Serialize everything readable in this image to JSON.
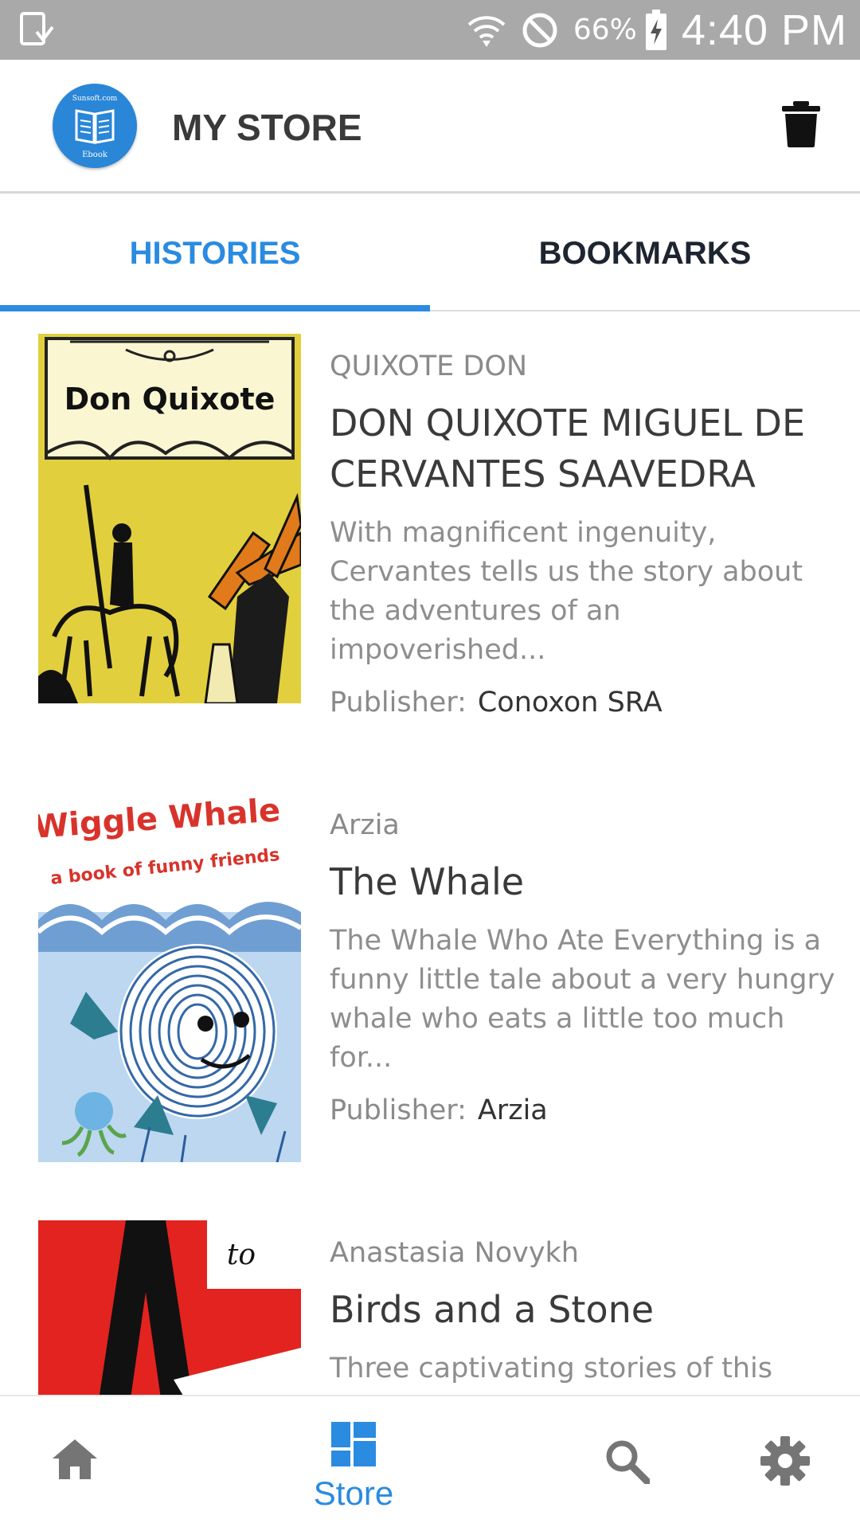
{
  "status_bar": {
    "battery_percent": "66%",
    "time": "4:40 PM",
    "icons": [
      "download-notification-icon",
      "wifi-icon",
      "do-not-disturb-icon",
      "battery-charging-icon"
    ]
  },
  "app_bar": {
    "title": "MY STORE",
    "logo_top_text": "Sunsoft.com",
    "logo_bottom_text": "Ebook",
    "action_icon": "trash-icon"
  },
  "tabs": [
    {
      "label": "HISTORIES",
      "selected": true
    },
    {
      "label": "BOOKMARKS",
      "selected": false
    }
  ],
  "books": [
    {
      "author": "QUIXOTE DON",
      "title": "DON QUIXOTE MIGUEL DE CERVANTES SAAVEDRA",
      "description": "With magnificent ingenuity, Cervantes tells us the story about the adventures of an impoverished...",
      "publisher_label": "Publisher:",
      "publisher": "Conoxon SRA",
      "cover_text": "Don Quixote"
    },
    {
      "author": "Arzia",
      "title": "The Whale",
      "description": "The Whale Who Ate Everything is a funny little tale about a very hungry whale who eats a little too much for...",
      "publisher_label": "Publisher:",
      "publisher": "Arzia",
      "cover_text": "Wiggle Whale",
      "cover_subtext": "a book of funny friends"
    },
    {
      "author": "Anastasia Novykh",
      "title": "Birds and a Stone",
      "description": "Three captivating stories of this book:",
      "cover_text": "to"
    }
  ],
  "bottom_nav": {
    "items": [
      {
        "icon": "home-icon",
        "label": ""
      },
      {
        "icon": "store-icon",
        "label": "Store",
        "selected": true
      },
      {
        "icon": "search-icon",
        "label": ""
      },
      {
        "icon": "gear-icon",
        "label": ""
      }
    ]
  },
  "colors": {
    "accent": "#2a8be0",
    "status_bar": "#a9a9a9",
    "logo": "#2a86d6"
  }
}
